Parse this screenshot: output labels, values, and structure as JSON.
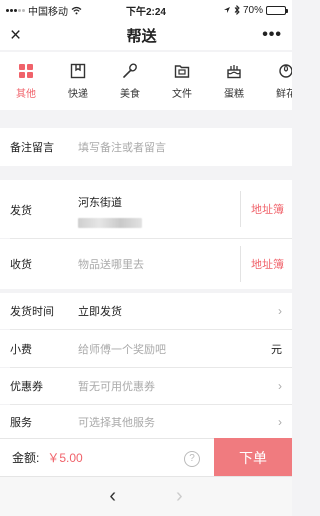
{
  "status": {
    "carrier": "中国移动",
    "time": "下午2:24",
    "battery": "70%",
    "battery_level": 0.7,
    "icons": [
      "signal-icon",
      "wifi-icon",
      "location-icon",
      "bluetooth-icon",
      "battery-icon"
    ]
  },
  "nav": {
    "title": "帮送",
    "close_icon": "×",
    "more_icon": "•••"
  },
  "categories": [
    {
      "label": "其他",
      "icon": "grid-icon",
      "active": true
    },
    {
      "label": "快递",
      "icon": "box-icon",
      "active": false
    },
    {
      "label": "美食",
      "icon": "spoon-icon",
      "active": false
    },
    {
      "label": "文件",
      "icon": "folder-icon",
      "active": false
    },
    {
      "label": "蛋糕",
      "icon": "cake-icon",
      "active": false
    },
    {
      "label": "鲜花",
      "icon": "flower-icon",
      "active": false
    }
  ],
  "note": {
    "label": "备注留言",
    "placeholder": "填写备注或者留言"
  },
  "sender": {
    "label": "发货",
    "street": "河东街道",
    "addr_book": "地址簿"
  },
  "receiver": {
    "label": "收货",
    "placeholder": "物品送哪里去",
    "addr_book": "地址簿"
  },
  "ship_time": {
    "label": "发货时间",
    "value": "立即发货"
  },
  "tip": {
    "label": "小费",
    "placeholder": "给师傅一个奖励吧",
    "unit": "元"
  },
  "coupon": {
    "label": "优惠券",
    "value": "暂无可用优惠券"
  },
  "service": {
    "label": "服务",
    "value": "可选择其他服务"
  },
  "footer": {
    "total_label": "金额:",
    "total_value": "￥5.00",
    "help": "?",
    "order_button": "下单"
  },
  "browser": {
    "back": "‹",
    "forward": "›"
  },
  "colors": {
    "accent": "#f0626a",
    "button": "#f07b7f"
  }
}
